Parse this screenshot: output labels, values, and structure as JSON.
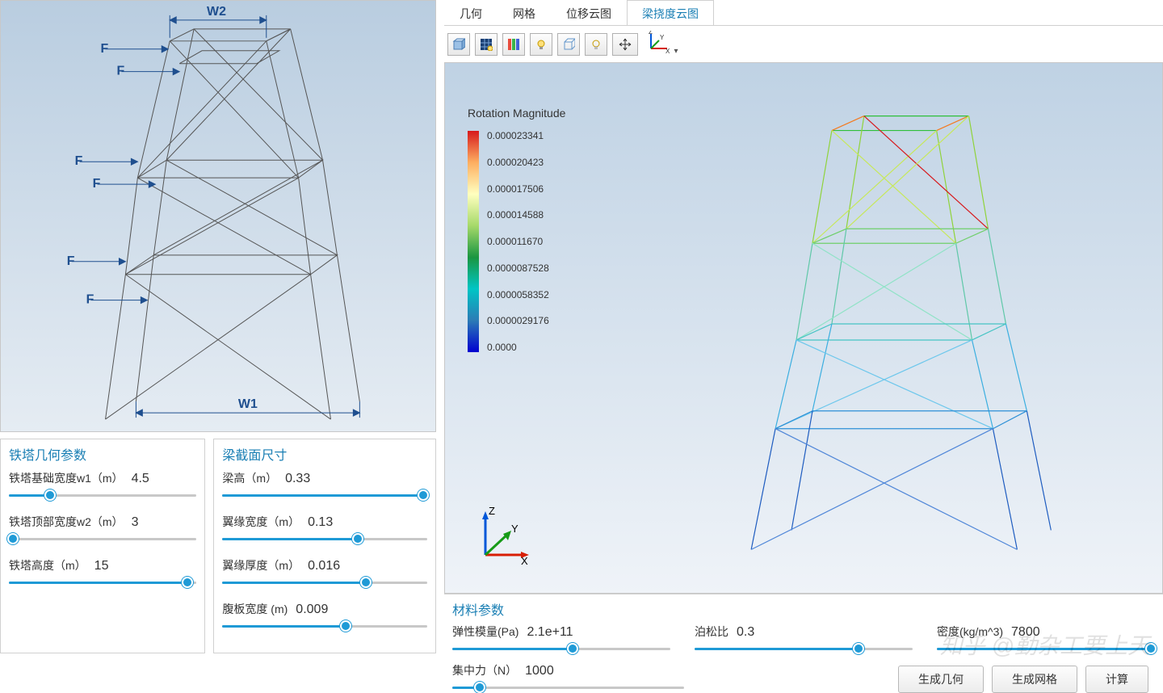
{
  "tabs": [
    "几何",
    "网格",
    "位移云图",
    "梁挠度云图"
  ],
  "active_tab_index": 3,
  "toolbar_icons": [
    "cube-icon",
    "grid-icon",
    "palette-icon",
    "light-icon",
    "cubeframe-icon",
    "lightbulb-icon",
    "move-icon",
    "axes-icon"
  ],
  "geometry_diagram": {
    "dimension_labels": {
      "top": "W2",
      "bottom": "W1"
    },
    "force_label": "F",
    "force_count": 6
  },
  "left_panels": {
    "geom": {
      "title": "铁塔几何参数",
      "params": [
        {
          "label": "铁塔基础宽度w1（m）",
          "value": "4.5",
          "pct": 22
        },
        {
          "label": "铁塔顶部宽度w2（m）",
          "value": "3",
          "pct": 2
        },
        {
          "label": "铁塔高度（m）",
          "value": "15",
          "pct": 95
        }
      ]
    },
    "section": {
      "title": "梁截面尺寸",
      "params": [
        {
          "label": "梁高（m）",
          "value": "0.33",
          "pct": 98
        },
        {
          "label": "翼缘宽度（m）",
          "value": "0.13",
          "pct": 66
        },
        {
          "label": "翼缘厚度（m）",
          "value": "0.016",
          "pct": 70
        },
        {
          "label": "腹板宽度 (m)",
          "value": "0.009",
          "pct": 60
        }
      ]
    }
  },
  "legend": {
    "title": "Rotation Magnitude",
    "ticks": [
      "0.000023341",
      "0.000020423",
      "0.000017506",
      "0.000014588",
      "0.000011670",
      "0.0000087528",
      "0.0000058352",
      "0.0000029176",
      "0.0000"
    ]
  },
  "axes_triad": {
    "x": "X",
    "y": "Y",
    "z": "Z"
  },
  "material": {
    "title": "材料参数",
    "params": [
      {
        "label": "弹性模量(Pa)",
        "value": "2.1e+11",
        "pct": 55
      },
      {
        "label": "泊松比",
        "value": "0.3",
        "pct": 75
      },
      {
        "label": "密度(kg/m^3)",
        "value": "7800",
        "pct": 98
      }
    ],
    "force": {
      "label": "集中力（N）",
      "value": "1000",
      "pct": 12
    }
  },
  "buttons": [
    "生成几何",
    "生成网格",
    "计算"
  ],
  "watermark": "知乎 @勤杂工要上天"
}
